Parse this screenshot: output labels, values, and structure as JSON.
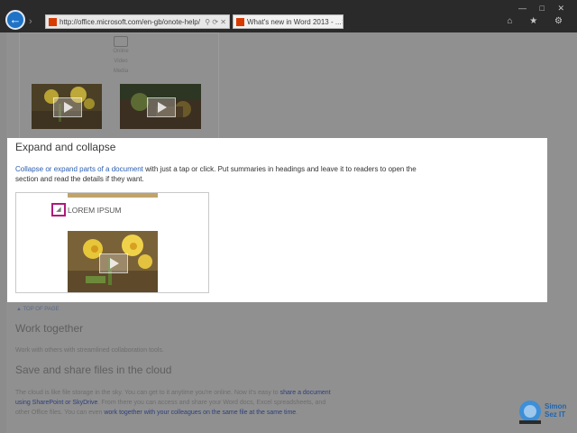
{
  "browser": {
    "address_url": "http://office.microsoft.com/en-gb/onote-help/",
    "tab_title": "What's new in Word 2013 - ...",
    "back_icon": "back-arrow-icon",
    "window_buttons": "— □ ✕",
    "toolbar_icons": "⌂ ★ ⚙"
  },
  "background_page": {
    "media_label": "Online Video Media",
    "top_of_page": "TOP OF PAGE",
    "work_together_heading": "Work together",
    "work_together_text": "Work with others with streamlined collaboration tools.",
    "save_share_heading": "Save and share files in the cloud",
    "cloud_text_1": "The cloud is like file storage in the sky. You can get to it anytime you're online. Now it's easy to",
    "cloud_link_1": "share a document",
    "cloud_link_2": "using SharePoint or SkyDrive",
    "cloud_text_2": ". From there you can access and share your Word docs, Excel spreadsheets, and",
    "cloud_text_3": "other Office files. You can even",
    "cloud_link_3": "work together with your colleagues on the same file at the same time",
    "cloud_text_4": "."
  },
  "highlight": {
    "title": "Expand and collapse",
    "link_text": "Collapse or expand parts of a document",
    "body_text": " with just a tap or click. Put summaries in headings and leave it to readers to open the section and read the details if they want.",
    "demo_heading": "LOREM IPSUM",
    "collapse_icon": "◢"
  },
  "logo": {
    "name_line1": "Simon",
    "name_line2": "Sez IT"
  },
  "colors": {
    "accent_blue": "#1f73c6",
    "link_blue": "#2a5db0",
    "highlight_border": "#b01a7a"
  }
}
